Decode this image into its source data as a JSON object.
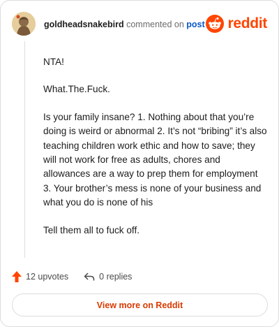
{
  "header": {
    "username": "goldheadsnakebird",
    "action_text": "commented on",
    "post_link": "post",
    "logo_text": "reddit",
    "avatar_icon": "user-avatar-icon"
  },
  "comment": {
    "paragraphs": [
      "NTA!",
      "What.The.Fuck.",
      "Is your family insane? 1. Nothing about that you’re doing is weird or abnormal 2. It’s not “bribing” it’s also teaching children work ethic and how to save; they will not work for free as adults, chores and allowances are a way to prep them for employment 3. Your brother’s mess is none of your business and what you do is none of his",
      "Tell them all to fuck off."
    ]
  },
  "footer": {
    "upvotes": "12 upvotes",
    "replies": "0 replies"
  },
  "cta": {
    "label": "View more on Reddit"
  },
  "colors": {
    "brand": "#ff4500",
    "link": "#0a58ca",
    "cta_text": "#d93a00"
  }
}
